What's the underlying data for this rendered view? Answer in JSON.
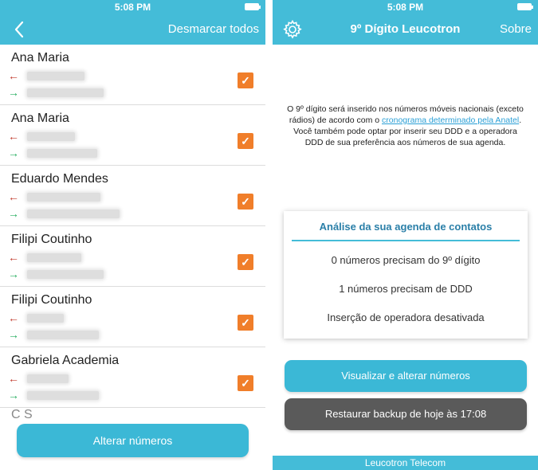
{
  "status_bar": {
    "time_left": "5:08 PM",
    "time_right": "5:08 PM"
  },
  "left_screen": {
    "nav": {
      "back_icon": "chevron-left-icon",
      "action_label": "Desmarcar todos"
    },
    "contacts": [
      {
        "name": "Ana Maria",
        "checked": true
      },
      {
        "name": "Ana Maria",
        "checked": true
      },
      {
        "name": "Eduardo Mendes",
        "checked": true
      },
      {
        "name": "Filipi Coutinho",
        "checked": true
      },
      {
        "name": "Filipi Coutinho",
        "checked": true
      },
      {
        "name": "Gabriela Academia",
        "checked": true
      }
    ],
    "partial_contact_name": "C        S",
    "primary_button_label": "Alterar números"
  },
  "right_screen": {
    "nav": {
      "settings_icon": "gear-icon",
      "title": "9º Dígito Leucotron",
      "action_label": "Sobre"
    },
    "info": {
      "text_part1": "O 9º dígito será inserido nos números móveis nacionais (exceto rádios) de acordo com o",
      "link_text": "cronograma determinado pela Anatel",
      "text_part2": ".",
      "text_part3": "Você também pode optar por inserir seu DDD e a operadora DDD de sua preferência aos números de sua agenda."
    },
    "analysis_card": {
      "title": "Análise da sua agenda de contatos",
      "line_1": "0 números precisam do 9º dígito",
      "line_2": "1 números precisam de DDD",
      "line_3": "Inserção de operadora desativada"
    },
    "view_button_label": "Visualizar e alterar números",
    "restore_button_label": "Restaurar backup de hoje às 17:08",
    "footer_text": "Leucotron Telecom"
  },
  "colors": {
    "accent": "#44bcd8",
    "button_blue": "#3bb8d6",
    "button_dark": "#5a5a5a",
    "checkbox_orange": "#f07e2a",
    "arrow_incoming": "#c0392b",
    "arrow_outgoing": "#27ae60",
    "link": "#2a9fd6"
  }
}
